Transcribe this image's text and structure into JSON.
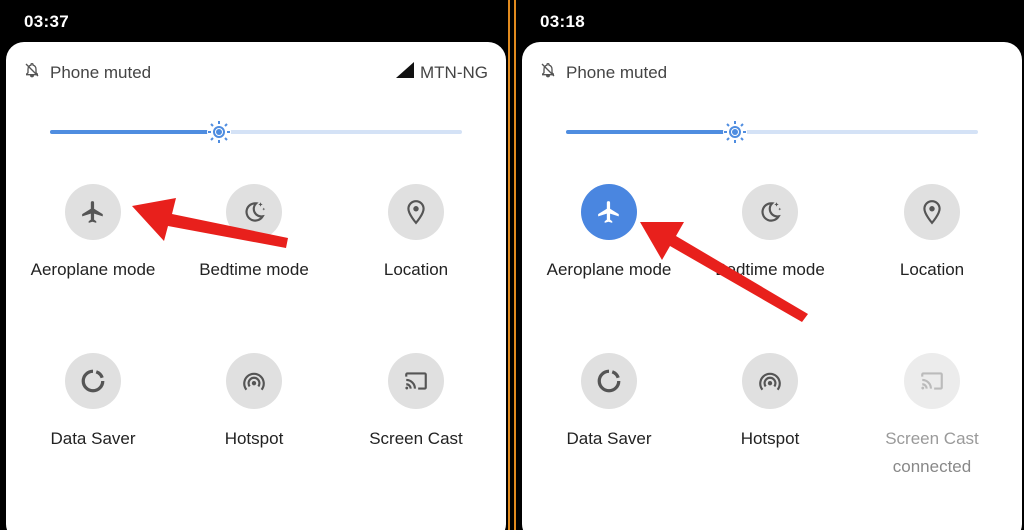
{
  "left": {
    "time": "03:37",
    "status": {
      "mute_text": "Phone muted",
      "carrier": "MTN-NG"
    },
    "brightness": 0.41,
    "tiles": [
      {
        "label": "Aeroplane mode",
        "icon": "airplane-icon",
        "active": false
      },
      {
        "label": "Bedtime mode",
        "icon": "bedtime-moon-icon",
        "active": false
      },
      {
        "label": "Location",
        "icon": "location-pin-icon",
        "active": false
      },
      {
        "label": "Data Saver",
        "icon": "data-saver-icon",
        "active": false
      },
      {
        "label": "Hotspot",
        "icon": "hotspot-icon",
        "active": false
      },
      {
        "label": "Screen Cast",
        "icon": "screen-cast-icon",
        "active": false
      }
    ]
  },
  "right": {
    "time": "03:18",
    "status": {
      "mute_text": "Phone muted"
    },
    "brightness": 0.41,
    "tiles": [
      {
        "label": "Aeroplane mode",
        "icon": "airplane-icon",
        "active": true
      },
      {
        "label": "Bedtime mode",
        "icon": "bedtime-moon-icon",
        "active": false
      },
      {
        "label": "Location",
        "icon": "location-pin-icon",
        "active": false
      },
      {
        "label": "Data Saver",
        "icon": "data-saver-icon",
        "active": false
      },
      {
        "label": "Hotspot",
        "icon": "hotspot-icon",
        "active": false
      },
      {
        "label": "Screen Cast",
        "icon": "screen-cast-icon",
        "active": false,
        "sub": "connected"
      }
    ]
  },
  "colors": {
    "accent": "#4a86e0",
    "tile_bg": "#e0e0e0",
    "arrow": "#e8201c",
    "border": "#e08a1e"
  }
}
